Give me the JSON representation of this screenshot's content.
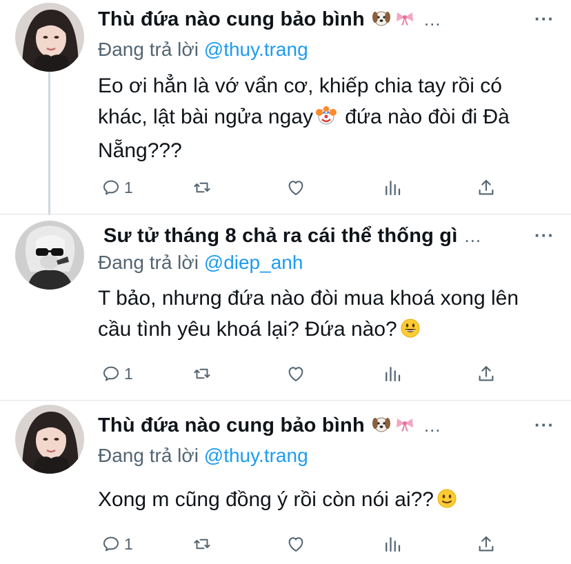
{
  "tweets": [
    {
      "name": "Thù đứa nào cung bảo bình",
      "ellipsis": "...",
      "more": "···",
      "replying_label": "Đang trả lời",
      "handle": "@thuy.trang",
      "text_before_emoji": "Eo ơi hẳn là vớ vẩn cơ, khiếp chia tay rồi có khác, lật bài ngửa ngay",
      "text_after_emoji": " đứa nào đòi đi Đà Nẵng???",
      "inline_emoji": "clown-face-icon",
      "reply_count": "1"
    },
    {
      "name": "Sư tử tháng 8 chả ra cái thể thống gì",
      "ellipsis": "...",
      "more": "···",
      "replying_label": "Đang trả lời",
      "handle": "@diep_anh",
      "text_before_emoji": "T bảo, nhưng đứa nào đòi mua khoá xong lên cầu tình yêu khoá lại? Đứa nào?",
      "text_after_emoji": "",
      "inline_emoji": "grinning-face-icon",
      "reply_count": "1"
    },
    {
      "name": "Thù đứa nào cung bảo bình",
      "ellipsis": "...",
      "more": "···",
      "replying_label": "Đang trả lời",
      "handle": "@thuy.trang",
      "text_before_emoji": "Xong m cũng đồng ý rồi còn nói ai??",
      "text_after_emoji": "",
      "inline_emoji": "slightly-smiling-face-icon",
      "reply_count": "1"
    }
  ],
  "colors": {
    "link": "#1d9bf0",
    "muted": "#536471",
    "thread_line": "#cfd9de",
    "divider": "#dde4e8"
  }
}
